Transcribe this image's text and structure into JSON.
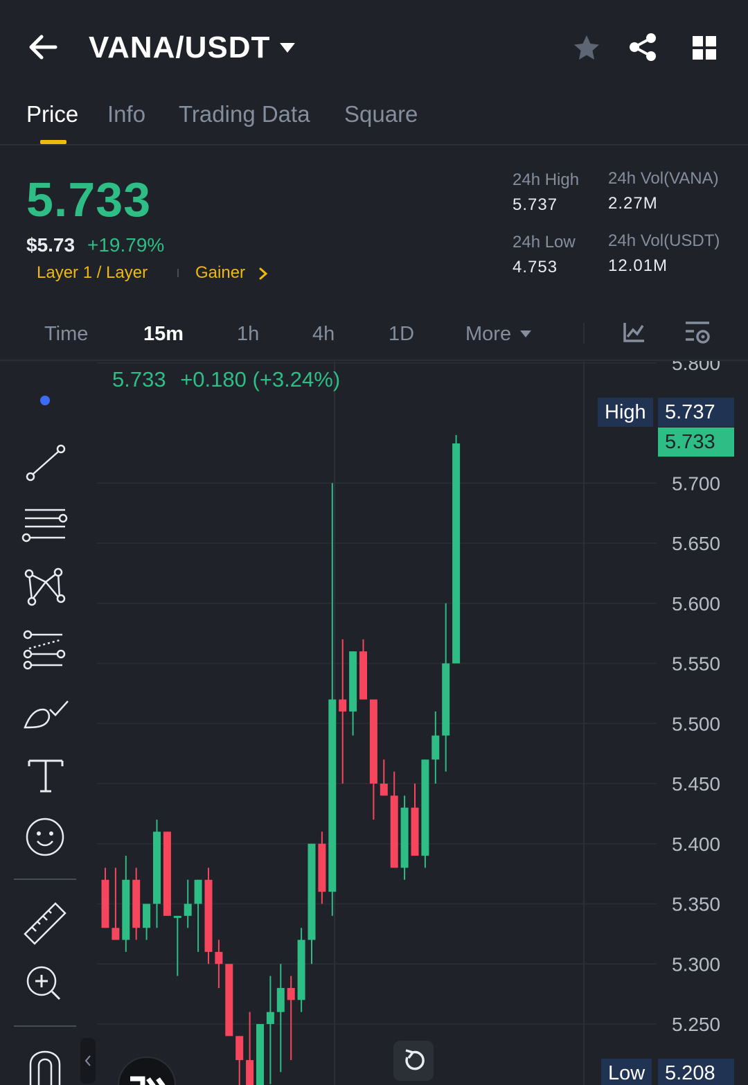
{
  "header": {
    "pair": "VANA/USDT",
    "icons": [
      "back-arrow-icon",
      "dropdown-caret-icon",
      "star-icon",
      "share-icon",
      "grid-icon"
    ]
  },
  "tabs": [
    {
      "label": "Price",
      "active": true
    },
    {
      "label": "Info",
      "active": false
    },
    {
      "label": "Trading Data",
      "active": false
    },
    {
      "label": "Square",
      "active": false
    }
  ],
  "price": {
    "last": "5.733",
    "usd": "$5.73",
    "change_pct": "+19.79%",
    "tag_category": "Layer 1 / Layer",
    "tag_gainer": "Gainer"
  },
  "stats": {
    "high_label": "24h High",
    "high_value": "5.737",
    "low_label": "24h Low",
    "low_value": "4.753",
    "vol_base_label": "24h Vol(VANA)",
    "vol_base_value": "2.27M",
    "vol_quote_label": "24h Vol(USDT)",
    "vol_quote_value": "12.01M"
  },
  "intervals": [
    {
      "label": "Time",
      "active": false
    },
    {
      "label": "15m",
      "active": true
    },
    {
      "label": "1h",
      "active": false
    },
    {
      "label": "4h",
      "active": false
    },
    {
      "label": "1D",
      "active": false
    },
    {
      "label": "More",
      "active": false
    }
  ],
  "chart_tooltip": {
    "price": "5.733",
    "change": "+0.180 (+3.24%)"
  },
  "markers": {
    "high_label": "High",
    "high_value": "5.737",
    "last_value": "5.733",
    "low_label": "Low",
    "low_value": "5.208"
  },
  "colors": {
    "up": "#2ebd85",
    "down": "#f6465d",
    "accent": "#f0b90b",
    "background": "#1f2229"
  },
  "chart_data": {
    "type": "candlestick",
    "title": "",
    "xlabel": "",
    "ylabel": "",
    "ylim": [
      5.2,
      5.8
    ],
    "yticks": [
      "5.800",
      "5.700",
      "5.650",
      "5.600",
      "5.550",
      "5.500",
      "5.450",
      "5.400",
      "5.350",
      "5.300",
      "5.250"
    ],
    "candles": [
      {
        "o": 5.37,
        "h": 5.38,
        "l": 5.33,
        "c": 5.33
      },
      {
        "o": 5.33,
        "h": 5.38,
        "l": 5.32,
        "c": 5.32
      },
      {
        "o": 5.32,
        "h": 5.39,
        "l": 5.31,
        "c": 5.37
      },
      {
        "o": 5.37,
        "h": 5.38,
        "l": 5.32,
        "c": 5.33
      },
      {
        "o": 5.33,
        "h": 5.35,
        "l": 5.32,
        "c": 5.35
      },
      {
        "o": 5.35,
        "h": 5.42,
        "l": 5.33,
        "c": 5.41
      },
      {
        "o": 5.41,
        "h": 5.41,
        "l": 5.34,
        "c": 5.34
      },
      {
        "o": 5.34,
        "h": 5.34,
        "l": 5.29,
        "c": 5.34
      },
      {
        "o": 5.34,
        "h": 5.37,
        "l": 5.33,
        "c": 5.35
      },
      {
        "o": 5.35,
        "h": 5.37,
        "l": 5.31,
        "c": 5.37
      },
      {
        "o": 5.37,
        "h": 5.38,
        "l": 5.3,
        "c": 5.31
      },
      {
        "o": 5.31,
        "h": 5.32,
        "l": 5.28,
        "c": 5.3
      },
      {
        "o": 5.3,
        "h": 5.3,
        "l": 5.24,
        "c": 5.24
      },
      {
        "o": 5.24,
        "h": 5.24,
        "l": 5.19,
        "c": 5.22
      },
      {
        "o": 5.22,
        "h": 5.26,
        "l": 5.2,
        "c": 5.19
      },
      {
        "o": 5.19,
        "h": 5.23,
        "l": 5.2,
        "c": 5.25
      },
      {
        "o": 5.25,
        "h": 5.29,
        "l": 5.2,
        "c": 5.26
      },
      {
        "o": 5.26,
        "h": 5.3,
        "l": 5.21,
        "c": 5.28
      },
      {
        "o": 5.28,
        "h": 5.29,
        "l": 5.22,
        "c": 5.27
      },
      {
        "o": 5.27,
        "h": 5.33,
        "l": 5.26,
        "c": 5.32
      },
      {
        "o": 5.32,
        "h": 5.4,
        "l": 5.3,
        "c": 5.4
      },
      {
        "o": 5.4,
        "h": 5.41,
        "l": 5.35,
        "c": 5.36
      },
      {
        "o": 5.36,
        "h": 5.7,
        "l": 5.34,
        "c": 5.52
      },
      {
        "o": 5.52,
        "h": 5.57,
        "l": 5.45,
        "c": 5.51
      },
      {
        "o": 5.51,
        "h": 5.56,
        "l": 5.49,
        "c": 5.56
      },
      {
        "o": 5.56,
        "h": 5.57,
        "l": 5.52,
        "c": 5.52
      },
      {
        "o": 5.52,
        "h": 5.51,
        "l": 5.42,
        "c": 5.45
      },
      {
        "o": 5.45,
        "h": 5.47,
        "l": 5.44,
        "c": 5.44
      },
      {
        "o": 5.44,
        "h": 5.46,
        "l": 5.38,
        "c": 5.38
      },
      {
        "o": 5.38,
        "h": 5.44,
        "l": 5.37,
        "c": 5.43
      },
      {
        "o": 5.43,
        "h": 5.45,
        "l": 5.39,
        "c": 5.39
      },
      {
        "o": 5.39,
        "h": 5.46,
        "l": 5.38,
        "c": 5.47
      },
      {
        "o": 5.47,
        "h": 5.51,
        "l": 5.45,
        "c": 5.49
      },
      {
        "o": 5.49,
        "h": 5.6,
        "l": 5.46,
        "c": 5.55
      },
      {
        "o": 5.55,
        "h": 5.74,
        "l": 5.55,
        "c": 5.733
      }
    ]
  },
  "toolbar": {
    "icons": [
      "trend-line-icon",
      "parallel-lines-icon",
      "pattern-icon",
      "fib-icon",
      "brush-icon",
      "text-icon",
      "emoji-icon",
      "ruler-icon",
      "zoom-in-icon",
      "magnet-icon"
    ]
  }
}
